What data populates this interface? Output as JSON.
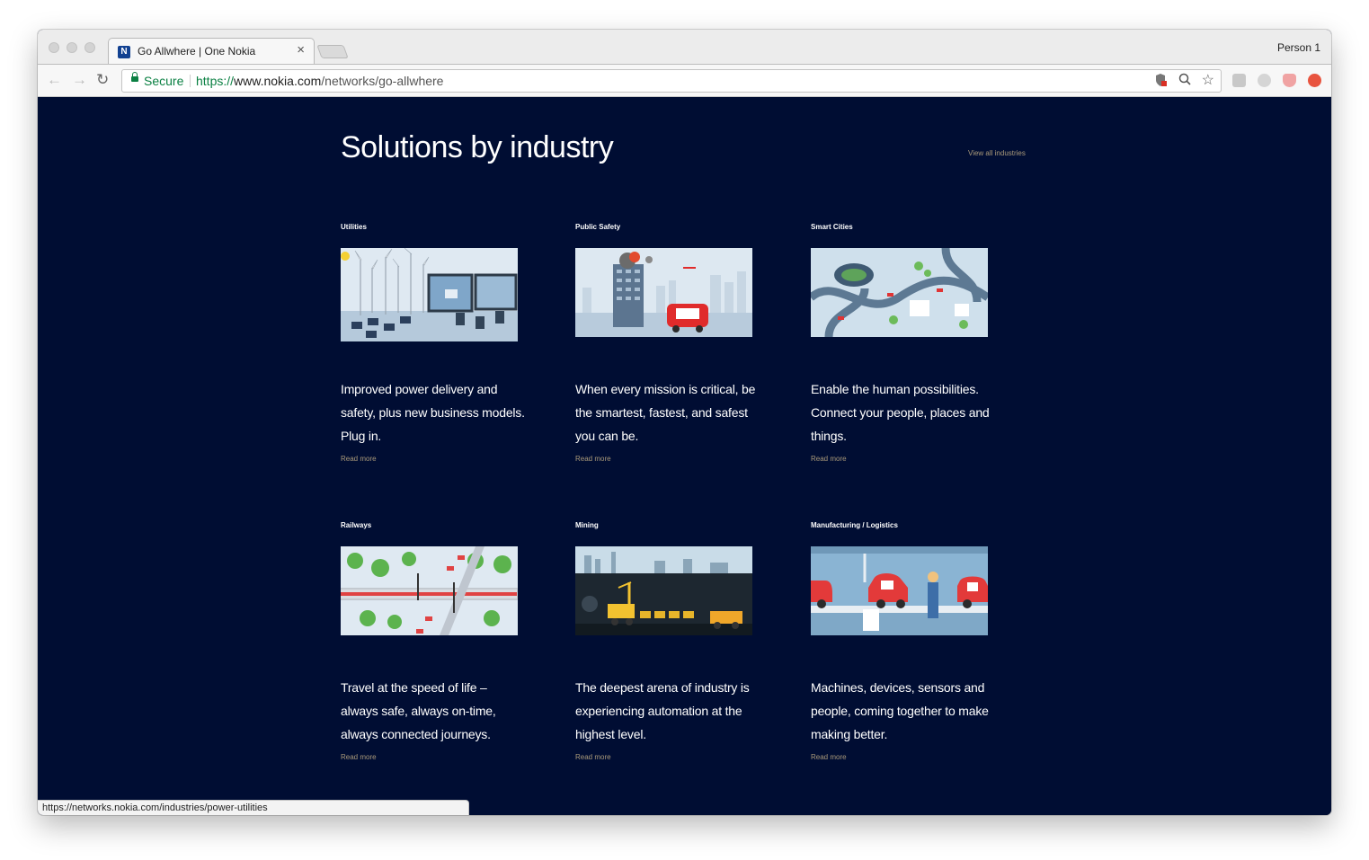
{
  "browser": {
    "tab_title": "Go Allwhere | One Nokia",
    "tab_icon": "nokia-favicon",
    "profile_name": "Person 1",
    "secure_label": "Secure",
    "url_scheme": "https://",
    "url_host": "www.nokia.com",
    "url_path": "/networks/go-allwhere",
    "status_url": "https://networks.nokia.com/industries/power-utilities"
  },
  "page": {
    "heading": "Solutions by industry",
    "view_all_label": "View all industries",
    "background_color": "#000d33",
    "link_color": "#aa9a7a",
    "industries": [
      {
        "name": "Utilities",
        "description": "Improved power delivery and safety, plus new business models. Plug in.",
        "link_label": "Read more",
        "illustration": "wind-turbines-control-room"
      },
      {
        "name": "Public Safety",
        "description": "When every mission is critical, be the smartest, fastest, and safest you can be.",
        "link_label": "Read more",
        "illustration": "burning-building-fire-truck"
      },
      {
        "name": "Smart Cities",
        "description": "Enable the human possibilities. Connect your people, places and things.",
        "link_label": "Read more",
        "illustration": "city-stadium-roads"
      },
      {
        "name": "Railways",
        "description": "Travel at the speed of life – always safe, always on-time, always connected journeys.",
        "link_label": "Read more",
        "illustration": "train-crossing-trees"
      },
      {
        "name": "Mining",
        "description": "The deepest arena of industry is experiencing automation at the highest level.",
        "link_label": "Read more",
        "illustration": "underground-mine-machinery"
      },
      {
        "name": "Manufacturing / Logistics",
        "description": "Machines, devices, sensors and people, coming together to make making better.",
        "link_label": "Read more",
        "illustration": "car-assembly-line"
      }
    ]
  }
}
